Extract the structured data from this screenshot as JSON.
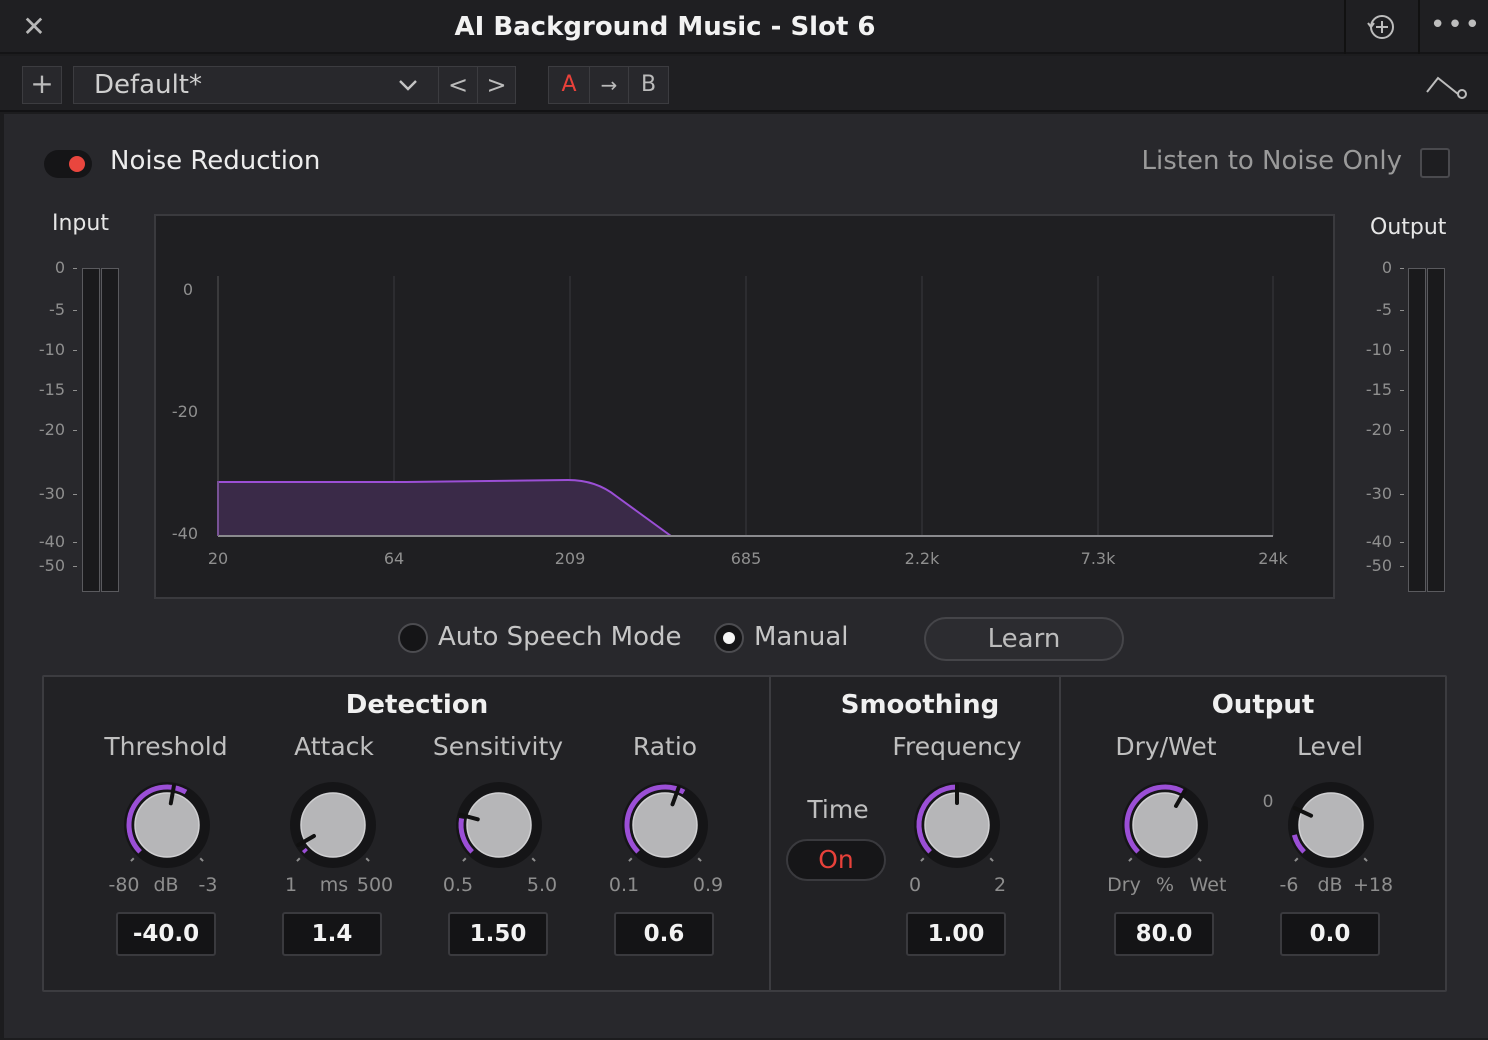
{
  "window": {
    "title": "AI Background Music - Slot 6",
    "close_glyph": "✕",
    "more_glyph": "•••"
  },
  "toolbar": {
    "add_glyph": "+",
    "preset": "Default*",
    "prev_glyph": "<",
    "next_glyph": ">",
    "ab_a": "A",
    "ab_copy": "→",
    "ab_b": "B"
  },
  "noise_reduction": {
    "label": "Noise Reduction",
    "enabled": true,
    "listen_label": "Listen to Noise Only",
    "listen_checked": false
  },
  "meters": {
    "input_title": "Input",
    "output_title": "Output",
    "ticks": [
      "0",
      "-5",
      "-10",
      "-15",
      "-20",
      "-30",
      "-40",
      "-50"
    ]
  },
  "graph": {
    "y_ticks": [
      "0",
      "-20",
      "-40"
    ],
    "x_ticks": [
      "20",
      "64",
      "209",
      "685",
      "2.2k",
      "7.3k",
      "24k"
    ]
  },
  "mode": {
    "auto_label": "Auto Speech Mode",
    "manual_label": "Manual",
    "selected": "manual",
    "learn_label": "Learn"
  },
  "detection": {
    "title": "Detection",
    "threshold": {
      "label": "Threshold",
      "min": "-80",
      "unit": "dB",
      "max": "-3",
      "value": "-40.0"
    },
    "attack": {
      "label": "Attack",
      "min": "1",
      "unit": "ms",
      "max": "500",
      "value": "1.4"
    },
    "sensitivity": {
      "label": "Sensitivity",
      "min": "0.5",
      "max": "5.0",
      "value": "1.50"
    },
    "ratio": {
      "label": "Ratio",
      "min": "0.1",
      "max": "0.9",
      "value": "0.6"
    }
  },
  "smoothing": {
    "title": "Smoothing",
    "time_label": "Time",
    "time_state": "On",
    "frequency": {
      "label": "Frequency",
      "min": "0",
      "max": "2",
      "value": "1.00"
    }
  },
  "output": {
    "title": "Output",
    "drywet": {
      "label": "Dry/Wet",
      "min": "Dry",
      "unit": "%",
      "max": "Wet",
      "value": "80.0"
    },
    "level": {
      "label": "Level",
      "zero_mark": "0",
      "min": "-6",
      "unit": "dB",
      "max": "+18",
      "value": "0.0"
    }
  },
  "colors": {
    "accent_red": "#e8413a",
    "knob_arc": "#9b4fd6",
    "graph_fill": "#3a2a48",
    "graph_line": "#9b4fd6"
  }
}
